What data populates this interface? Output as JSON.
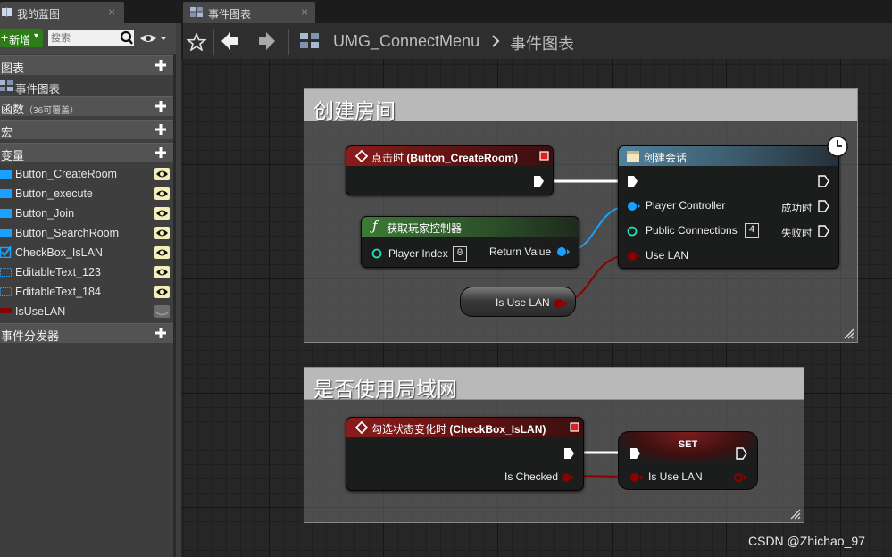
{
  "left_panel": {
    "tab": {
      "label": "我的蓝图",
      "close": "×"
    },
    "toolbar": {
      "new_label": "新增",
      "search_placeholder": "搜索"
    },
    "sections": {
      "graphs": {
        "label": "图表"
      },
      "graph_item": "事件图表",
      "functions": {
        "label": "函数",
        "count": "（36可覆盖）"
      },
      "macros": {
        "label": "宏"
      },
      "variables": {
        "label": "变量"
      },
      "dispatchers": {
        "label": "事件分发器"
      }
    },
    "variables": [
      {
        "name": "Button_CreateRoom",
        "type": "widget",
        "visible": true
      },
      {
        "name": "Button_execute",
        "type": "widget",
        "visible": true
      },
      {
        "name": "Button_Join",
        "type": "widget",
        "visible": true
      },
      {
        "name": "Button_SearchRoom",
        "type": "widget",
        "visible": true
      },
      {
        "name": "CheckBox_IsLAN",
        "type": "checkbox",
        "visible": true
      },
      {
        "name": "EditableText_123",
        "type": "text",
        "visible": true
      },
      {
        "name": "EditableText_184",
        "type": "text",
        "visible": true
      },
      {
        "name": "IsUseLAN",
        "type": "bool",
        "visible": false
      }
    ]
  },
  "editor": {
    "tab": {
      "label": "事件图表",
      "close": "×"
    },
    "breadcrumb": {
      "blueprint": "UMG_ConnectMenu",
      "graph": "事件图表"
    }
  },
  "graph": {
    "comment1": {
      "title": "创建房间"
    },
    "comment2": {
      "title": "是否使用局域网"
    },
    "node_onclick": {
      "prefix": "点击时 ",
      "target": "(Button_CreateRoom)"
    },
    "node_getpc": {
      "title": "获取玩家控制器",
      "player_index_label": "Player Index",
      "player_index_value": "0",
      "return_label": "Return Value"
    },
    "node_create_session": {
      "title": "创建会话",
      "pin_pc": "Player Controller",
      "pin_conn": "Public Connections",
      "conn_value": "4",
      "pin_lan": "Use LAN",
      "on_success": "成功时",
      "on_failure": "失败时"
    },
    "node_var": {
      "label": "Is Use LAN"
    },
    "node_checkchanged": {
      "prefix": "勾选状态变化时 ",
      "target": "(CheckBox_IsLAN)",
      "pin_checked": "Is Checked"
    },
    "node_set": {
      "title": "SET",
      "pin": "Is Use LAN"
    }
  },
  "colors": {
    "exec": "#ffffff",
    "object_pin": "#1aa0ff",
    "int_pin": "#1de2b6",
    "bool_pin": "#8b0000",
    "event_header": "#8a1c1c",
    "pure_header": "#3d7a36",
    "function_header": "#51829c"
  },
  "watermark": "CSDN @Zhichao_97"
}
